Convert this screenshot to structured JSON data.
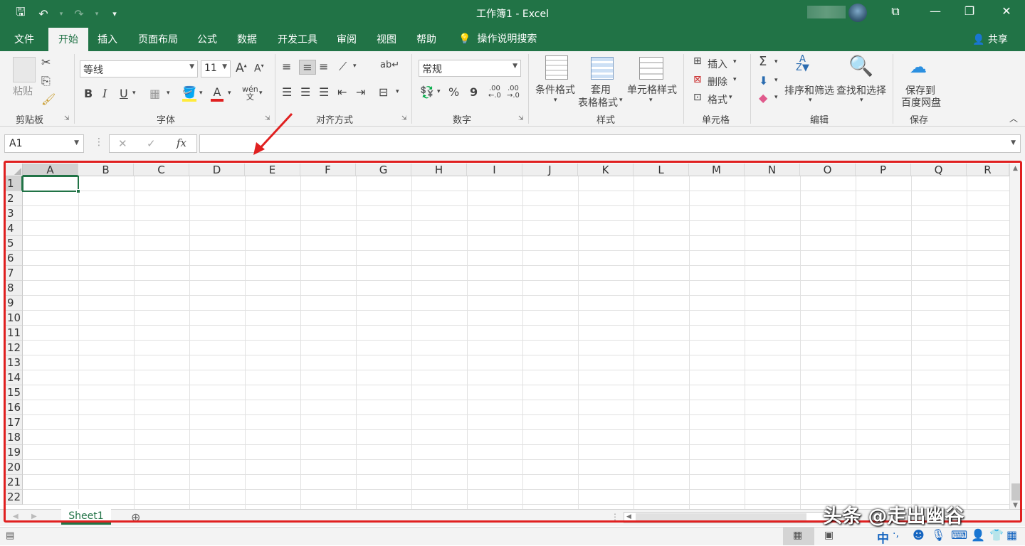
{
  "window": {
    "title": "工作簿1  -  Excel"
  },
  "qat": {
    "save": "🖫",
    "undo": "↶",
    "redo": "↷",
    "customize": "▾"
  },
  "window_controls": {
    "ribbon_options": "⧉",
    "minimize": "—",
    "restore": "❐",
    "close": "✕"
  },
  "tabs": [
    {
      "label": "文件"
    },
    {
      "label": "开始"
    },
    {
      "label": "插入"
    },
    {
      "label": "页面布局"
    },
    {
      "label": "公式"
    },
    {
      "label": "数据"
    },
    {
      "label": "开发工具"
    },
    {
      "label": "审阅"
    },
    {
      "label": "视图"
    },
    {
      "label": "帮助"
    }
  ],
  "tell_me": "操作说明搜索",
  "share": "共享",
  "ribbon": {
    "clipboard": {
      "label": "剪贴板",
      "paste": "粘贴"
    },
    "font": {
      "label": "字体",
      "name": "等线",
      "size": "11",
      "bold": "B",
      "italic": "I",
      "underline": "U",
      "grow": "A",
      "shrink": "A",
      "wen": "wén"
    },
    "alignment": {
      "label": "对齐方式"
    },
    "number": {
      "label": "数字",
      "format": "常规",
      "percent": "%",
      "comma": "9",
      "inc_dec": ".00",
      "dec_dec": ".00"
    },
    "styles": {
      "label": "样式",
      "conditional": "条件格式",
      "table_1": "套用",
      "table_2": "表格格式",
      "cell_styles": "单元格样式"
    },
    "cells": {
      "label": "单元格",
      "insert": "插入",
      "delete": "删除",
      "format": "格式"
    },
    "editing": {
      "label": "编辑",
      "sort_filter": "排序和筛选",
      "find_select": "查找和选择"
    },
    "save": {
      "label": "保存",
      "line1": "保存到",
      "line2": "百度网盘"
    }
  },
  "formula_bar": {
    "name_box": "A1",
    "fx": "fx",
    "cancel": "✕",
    "enter": "✓"
  },
  "columns": [
    "A",
    "B",
    "C",
    "D",
    "E",
    "F",
    "G",
    "H",
    "I",
    "J",
    "K",
    "L",
    "M",
    "N",
    "O",
    "P",
    "Q",
    "R"
  ],
  "rows": [
    "1",
    "2",
    "3",
    "4",
    "5",
    "6",
    "7",
    "8",
    "9",
    "10",
    "11",
    "12",
    "13",
    "14",
    "15",
    "16",
    "17",
    "18",
    "19",
    "20",
    "21",
    "22"
  ],
  "sheets": [
    "Sheet1"
  ],
  "watermark": "头条 @走出幽谷",
  "colors": {
    "excel_green": "#217346",
    "annotation_red": "#e02020"
  }
}
